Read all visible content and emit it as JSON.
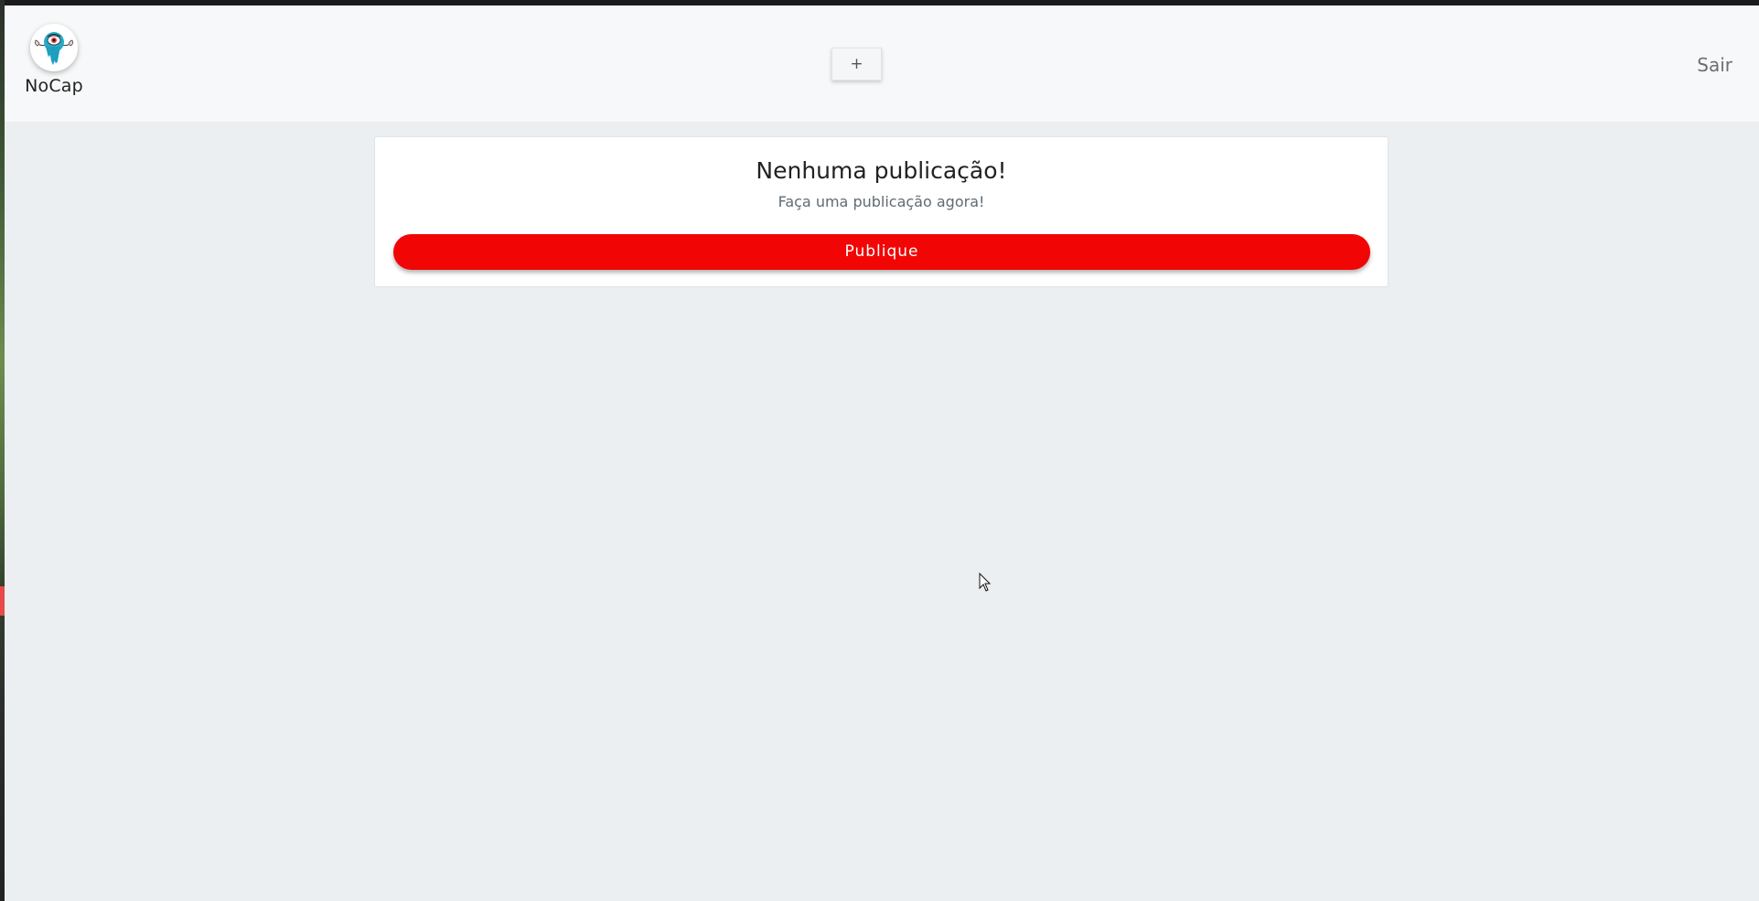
{
  "navbar": {
    "brand_name": "NoCap",
    "brand_logo_icon": "eye-monster-icon",
    "add_label": "+",
    "logout_label": "Sair"
  },
  "feed": {
    "empty_title": "Nenhuma publicação!",
    "empty_subtitle": "Faça uma publicação agora!",
    "publish_label": "Publique"
  },
  "colors": {
    "accent": "#f20505",
    "page_background": "#ebeff2",
    "navbar_background": "#f7f8f9"
  }
}
